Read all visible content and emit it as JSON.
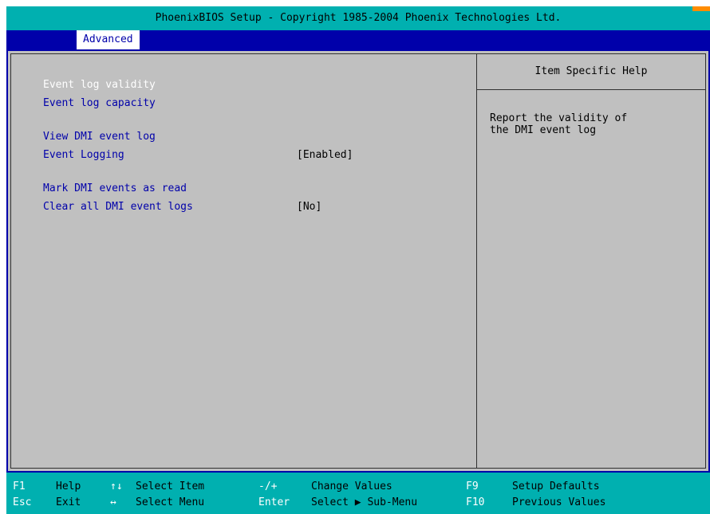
{
  "title": "PhoenixBIOS Setup - Copyright 1985-2004 Phoenix Technologies Ltd.",
  "menu": {
    "active_tab": "Advanced"
  },
  "items": [
    {
      "label": "Event log validity",
      "value": "",
      "selected": true
    },
    {
      "label": "Event log capacity",
      "value": ""
    },
    {
      "label": "View DMI event log",
      "value": ""
    },
    {
      "label": "Event Logging",
      "value": "[Enabled]"
    },
    {
      "label": "Mark DMI events as read",
      "value": ""
    },
    {
      "label": "Clear all DMI event logs",
      "value": "[No]"
    }
  ],
  "help": {
    "title": "Item Specific Help",
    "text": "Report the validity of\nthe DMI event log"
  },
  "statusbar": {
    "row1": [
      {
        "key": "F1",
        "label": "Help"
      },
      {
        "key": "↑↓",
        "label": "Select Item"
      },
      {
        "key": "-/+",
        "label": "Change Values"
      },
      {
        "key": "F9",
        "label": "Setup Defaults"
      }
    ],
    "row2": [
      {
        "key": "Esc",
        "label": "Exit"
      },
      {
        "key": "↔",
        "label": "Select Menu"
      },
      {
        "key": "Enter",
        "label": "Select ▶ Sub-Menu"
      },
      {
        "key": "F10",
        "label": "Previous Values"
      }
    ]
  },
  "colors": {
    "background_blue": "#0000aa",
    "panel_gray": "#c0c0c0",
    "bar_cyan": "#00b0b0",
    "selected_text": "#ffffff"
  }
}
